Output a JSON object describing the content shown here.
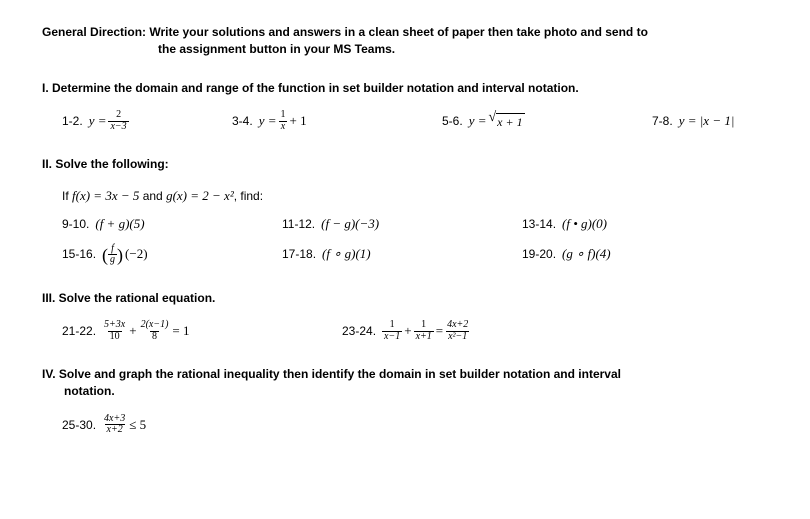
{
  "general_direction": {
    "line1": "General Direction: Write your solutions and answers in a clean sheet of paper then take photo and send to",
    "line2": "the assignment button in your MS Teams."
  },
  "sections": {
    "I": {
      "heading": "I.  Determine the domain and range of the function in set builder notation and interval notation.",
      "items": {
        "q1_label": "1-2.",
        "q1_lhs": "y =",
        "q1_num": "2",
        "q1_den": "x−3",
        "q2_label": "3-4.",
        "q2_lhs": "y =",
        "q2_num": "1",
        "q2_den": "x",
        "q2_tail": "+ 1",
        "q3_label": "5-6.",
        "q3_lhs": "y =",
        "q3_radicand": "x + 1",
        "q4_label": "7-8.",
        "q4_expr": "y = |x − 1|"
      }
    },
    "II": {
      "heading": "II. Solve the following:",
      "prompt_a": "If ",
      "prompt_b": "f(x) = 3x − 5",
      "prompt_c": " and ",
      "prompt_d": "g(x) = 2 − x²",
      "prompt_e": ",  find:",
      "items": {
        "q9_label": "9-10.",
        "q9_expr": "(f + g)(5)",
        "q11_label": "11-12.",
        "q11_expr": "(f − g)(−3)",
        "q13_label": "13-14.",
        "q13_expr": "(f • g)(0)",
        "q15_label": "15-16.",
        "q15_num": "f",
        "q15_den": "g",
        "q15_tail": "(−2)",
        "q17_label": "17-18.",
        "q17_expr": "(f ∘ g)(1)",
        "q19_label": "19-20.",
        "q19_expr": "(g ∘ f)(4)"
      }
    },
    "III": {
      "heading": "III. Solve the rational equation.",
      "items": {
        "q21_label": "21-22.",
        "q21_f1_num": "5+3x",
        "q21_f1_den": "10",
        "q21_plus": "+",
        "q21_f2_num": "2(x−1)",
        "q21_f2_den": "8",
        "q21_tail": "= 1",
        "q23_label": "23-24.",
        "q23_f1_num": "1",
        "q23_f1_den": "x−1",
        "q23_plus": "+",
        "q23_f2_num": "1",
        "q23_f2_den": "x+1",
        "q23_eq": "=",
        "q23_f3_num": "4x+2",
        "q23_f3_den": "x²−1"
      }
    },
    "IV": {
      "heading_line1": "IV. Solve and graph the rational inequality then identify the domain in set builder notation and interval",
      "heading_line2": "notation.",
      "items": {
        "q25_label": "25-30.",
        "q25_num": "4x+3",
        "q25_den": "x+2",
        "q25_tail": "≤ 5"
      }
    }
  }
}
